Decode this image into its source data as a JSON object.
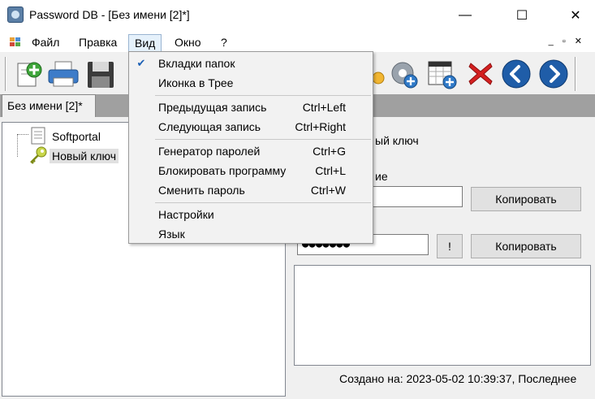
{
  "window": {
    "title": "Password DB - [Без имени [2]*]",
    "controls": {
      "minimize": "—",
      "maximize": "☐",
      "close": "✕"
    }
  },
  "menubar": {
    "items": [
      "Файл",
      "Правка",
      "Вид",
      "Окно",
      "?"
    ],
    "active": "Вид",
    "mdi_controls": "_ ▫ ✕"
  },
  "toolbar": {
    "buttons": [
      "new-entry-icon",
      "print-icon",
      "save-icon",
      "gear-add-icon",
      "calendar-add-icon",
      "delete-icon",
      "back-icon",
      "forward-icon"
    ]
  },
  "tabs": [
    {
      "label": "Без имени [2]*"
    }
  ],
  "tree": {
    "root": "Softportal",
    "child": "Новый ключ"
  },
  "details": {
    "title_fragment": "ый ключ",
    "login_label_fragment": "ие",
    "password_mask": "●●●●●●●",
    "copy_label": "Копировать",
    "reveal_label": "!",
    "created_text": "Создано на: 2023-05-02 10:39:37, Последнее"
  },
  "view_menu": {
    "items": [
      {
        "label": "Вкладки папок",
        "shortcut": "",
        "checked": true
      },
      {
        "label": "Иконка в Трее",
        "shortcut": "",
        "checked": false
      },
      {
        "label": "Предыдущая запись",
        "shortcut": "Ctrl+Left",
        "checked": false
      },
      {
        "label": "Следующая запись",
        "shortcut": "Ctrl+Right",
        "checked": false
      },
      {
        "label": "Генератор паролей",
        "shortcut": "Ctrl+G",
        "checked": false
      },
      {
        "label": "Блокировать программу",
        "shortcut": "Ctrl+L",
        "checked": false
      },
      {
        "label": "Сменить пароль",
        "shortcut": "Ctrl+W",
        "checked": false
      },
      {
        "label": "Настройки",
        "shortcut": "",
        "checked": false
      },
      {
        "label": "Язык",
        "shortcut": "",
        "checked": false
      }
    ],
    "check_mark": "✔"
  },
  "colors": {
    "accent_blue": "#1b5fb5",
    "menu_highlight": "#e5f1fb",
    "delete_red": "#d42020"
  }
}
